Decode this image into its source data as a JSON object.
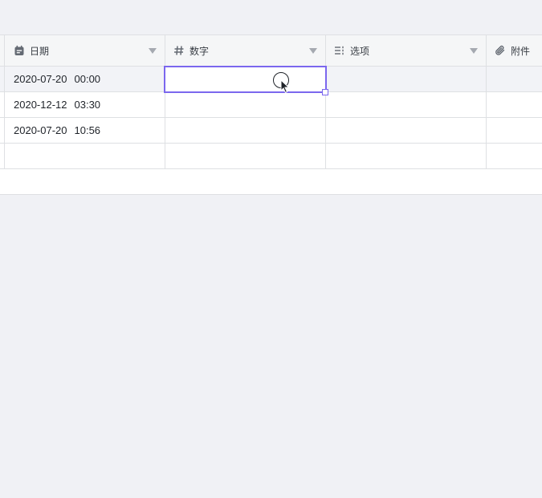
{
  "columns": {
    "date": {
      "label": "日期",
      "icon": "calendar-icon"
    },
    "number": {
      "label": "数字",
      "icon": "hash-icon"
    },
    "options": {
      "label": "选项",
      "icon": "list-icon"
    },
    "attachment": {
      "label": "附件",
      "icon": "paperclip-icon"
    }
  },
  "rows": [
    {
      "date": "2020-07-20",
      "time": "00:00"
    },
    {
      "date": "2020-12-12",
      "time": "03:30"
    },
    {
      "date": "2020-07-20",
      "time": "10:56"
    },
    {
      "date": "",
      "time": ""
    }
  ],
  "colors": {
    "accent": "#7b67ee",
    "grid_line": "#dee0e3",
    "background": "#f0f1f5"
  }
}
